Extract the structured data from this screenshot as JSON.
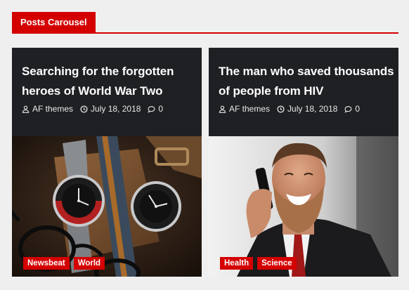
{
  "widget": {
    "title": "Posts Carousel"
  },
  "posts": [
    {
      "title": "Searching for the forgotten heroes of World War Two",
      "author": "AF themes",
      "date": "July 18, 2018",
      "comments": "0",
      "image_icon": "watches-image",
      "categories": [
        "Newsbeat",
        "World"
      ]
    },
    {
      "title": "The man who saved thousands of people from HIV",
      "author": "AF themes",
      "date": "July 18, 2018",
      "comments": "0",
      "image_icon": "bearded-man-phone-image",
      "categories": [
        "Health",
        "Science"
      ]
    }
  ],
  "colors": {
    "accent": "#d40000",
    "card_bg": "#1f2024",
    "page_bg": "#efefef"
  }
}
